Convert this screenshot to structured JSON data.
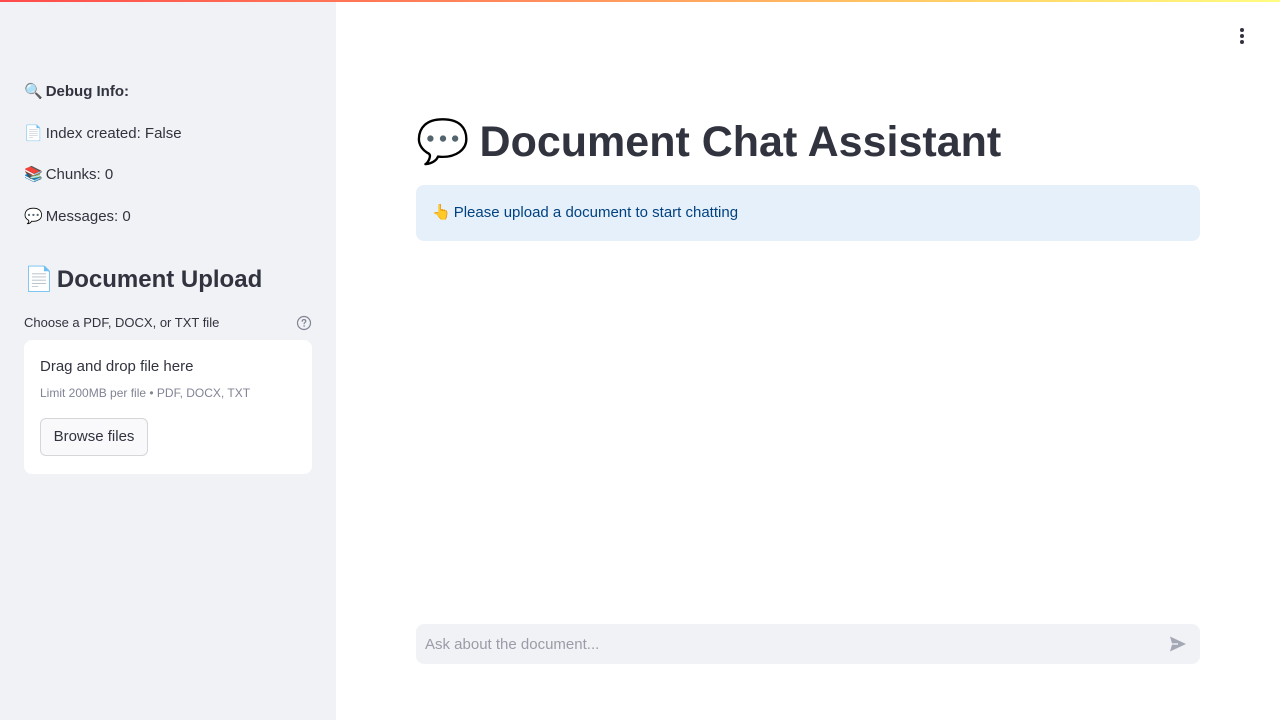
{
  "sidebar": {
    "debug": {
      "title_icon": "🔍",
      "title": "Debug Info:",
      "index_icon": "📄",
      "index_text": "Index created: False",
      "chunks_icon": "📚",
      "chunks_text": "Chunks: 0",
      "messages_icon": "💬",
      "messages_text": "Messages: 0"
    },
    "upload": {
      "heading_icon": "📄",
      "heading": "Document Upload",
      "label": "Choose a PDF, DOCX, or TXT file",
      "help_icon": "question-circle-icon",
      "dropzone_title": "Drag and drop file here",
      "dropzone_limit": "Limit 200MB per file • PDF, DOCX, TXT",
      "browse_label": "Browse files"
    }
  },
  "header": {
    "menu_icon": "vertical-dots-icon"
  },
  "main": {
    "title_icon": "💬",
    "title": "Document Chat Assistant",
    "info_icon": "👆",
    "info_text": "Please upload a document to start chatting",
    "chat_placeholder": "Ask about the document...",
    "send_icon": "send-arrow-icon"
  },
  "colors": {
    "sidebar_bg": "#f0f2f6",
    "info_bg": "#e6f0fa",
    "info_text": "#004280",
    "text": "#31333f",
    "muted": "#808495",
    "accent_gradient": [
      "#ff4b4b",
      "#ffd166",
      "#fffd80"
    ]
  }
}
